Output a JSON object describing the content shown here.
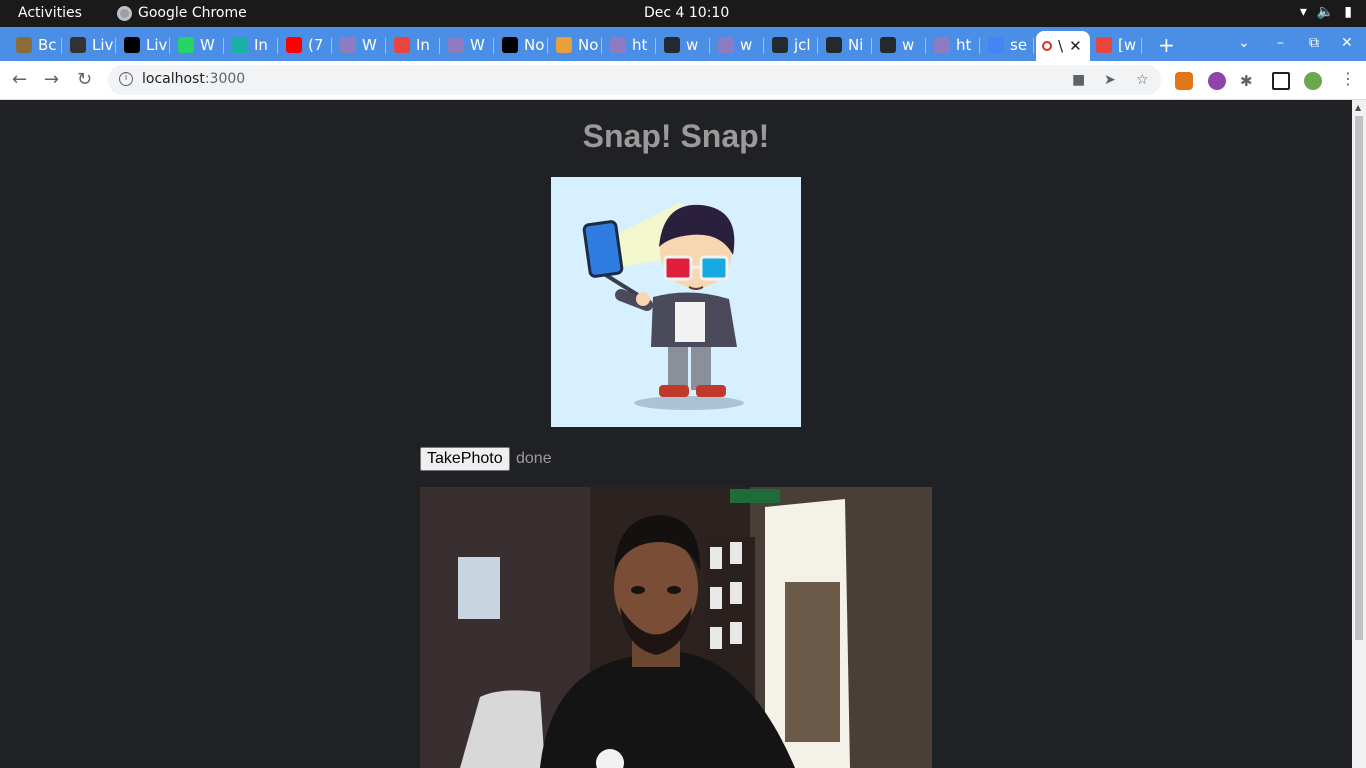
{
  "system": {
    "activities": "Activities",
    "app_name": "Google Chrome",
    "clock": "Dec 4  10:10"
  },
  "tabs": [
    {
      "label": "Bc",
      "color": "#8a6d3b"
    },
    {
      "label": "Liv",
      "color": "#333333"
    },
    {
      "label": "Liv",
      "color": "#000000"
    },
    {
      "label": "W",
      "color": "#25d366"
    },
    {
      "label": "In",
      "color": "#1ab0a8"
    },
    {
      "label": "(7",
      "color": "#ff0000"
    },
    {
      "label": "W",
      "color": "#8e7cc3"
    },
    {
      "label": "In",
      "color": "#e8453c"
    },
    {
      "label": "W",
      "color": "#8e7cc3"
    },
    {
      "label": "No",
      "color": "#000000"
    },
    {
      "label": "No",
      "color": "#e8a03c"
    },
    {
      "label": "ht",
      "color": "#8e7cc3"
    },
    {
      "label": "w",
      "color": "#24292e"
    },
    {
      "label": "w",
      "color": "#8e7cc3"
    },
    {
      "label": "jcl",
      "color": "#24292e"
    },
    {
      "label": "Ni",
      "color": "#24292e"
    },
    {
      "label": "w",
      "color": "#24292e"
    },
    {
      "label": "ht",
      "color": "#8e7cc3"
    },
    {
      "label": "se",
      "color": "#4285f4"
    },
    {
      "label": "\\",
      "color": "#d93025",
      "active": true
    },
    {
      "label": "[w",
      "color": "#e8453c"
    }
  ],
  "toolbar": {
    "url_host": "localhost",
    "url_port": ":3000"
  },
  "page": {
    "title": "Snap! Snap!",
    "take_photo_label": "TakePhoto",
    "status": "done"
  }
}
